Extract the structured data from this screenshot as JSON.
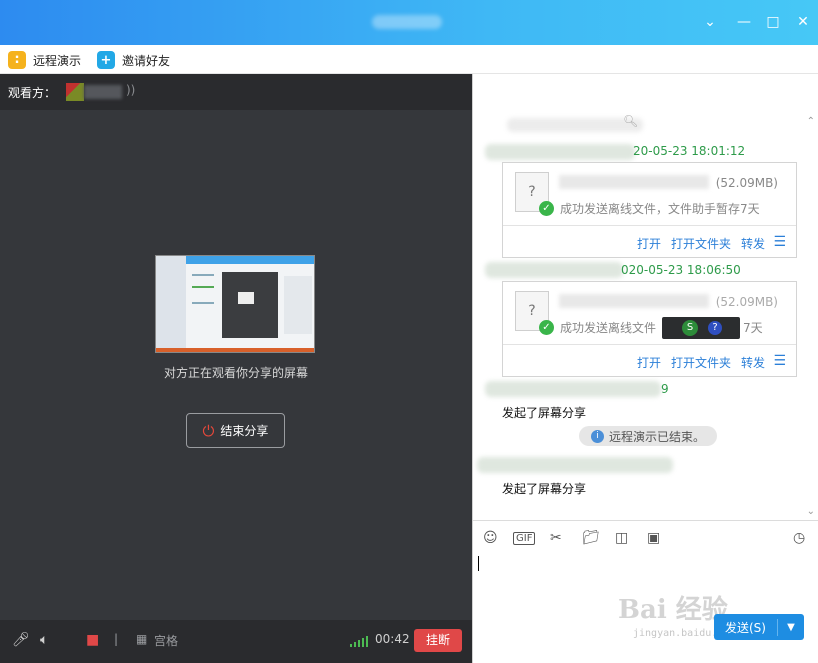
{
  "toolbar": {
    "remote_demo": "远程演示",
    "invite_friend": "邀请好友"
  },
  "left": {
    "viewer_label": "观看方：",
    "sharing_text": "对方正在观看你分享的屏幕",
    "end_share": "结束分享",
    "grid_label": "宫格",
    "timer": "00:42",
    "hangup": "挂断"
  },
  "chat": {
    "messages": [
      {
        "time": "20-05-23 18:01:12",
        "file_size": "(52.09MB)",
        "status": "成功发送离线文件，文件助手暂存7天"
      },
      {
        "time": "020-05-23 18:06:50",
        "file_size": "(52.09MB)",
        "status": "成功发送离线文件",
        "status_tail": "7天"
      }
    ],
    "actions": {
      "open": "打开",
      "open_folder": "打开文件夹",
      "forward": "转发"
    },
    "time3_tail": "9",
    "started_share_1": "发起了屏幕分享",
    "ended_tip": "远程演示已结束。",
    "started_share_2": "发起了屏幕分享"
  },
  "input": {
    "send_label": "发送(S)"
  },
  "watermark": {
    "main": "Bai 经验",
    "sub": "jingyan.baidu.com"
  },
  "colors": {
    "titlebar": "#3fb8f5",
    "accent": "#1e8de2",
    "hangup": "#e04848",
    "time_green": "#2e9b4a"
  }
}
